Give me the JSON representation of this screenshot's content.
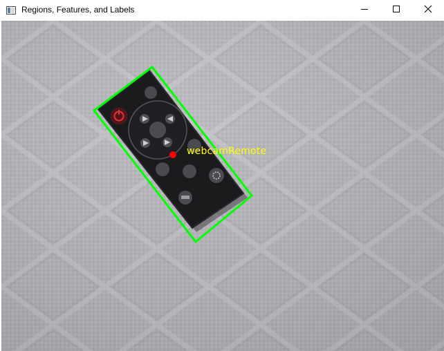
{
  "window": {
    "title": "Regions, Features, and Labels",
    "controls": [
      "minimize-icon",
      "maximize-icon",
      "close-icon"
    ]
  },
  "detection": {
    "label": "webcamRemote",
    "box_color": "#00ff00",
    "centroid_color": "#ff0000",
    "label_color": "#ffff00"
  },
  "scene": {
    "object": "remote-control",
    "background": "textured paper towel"
  }
}
